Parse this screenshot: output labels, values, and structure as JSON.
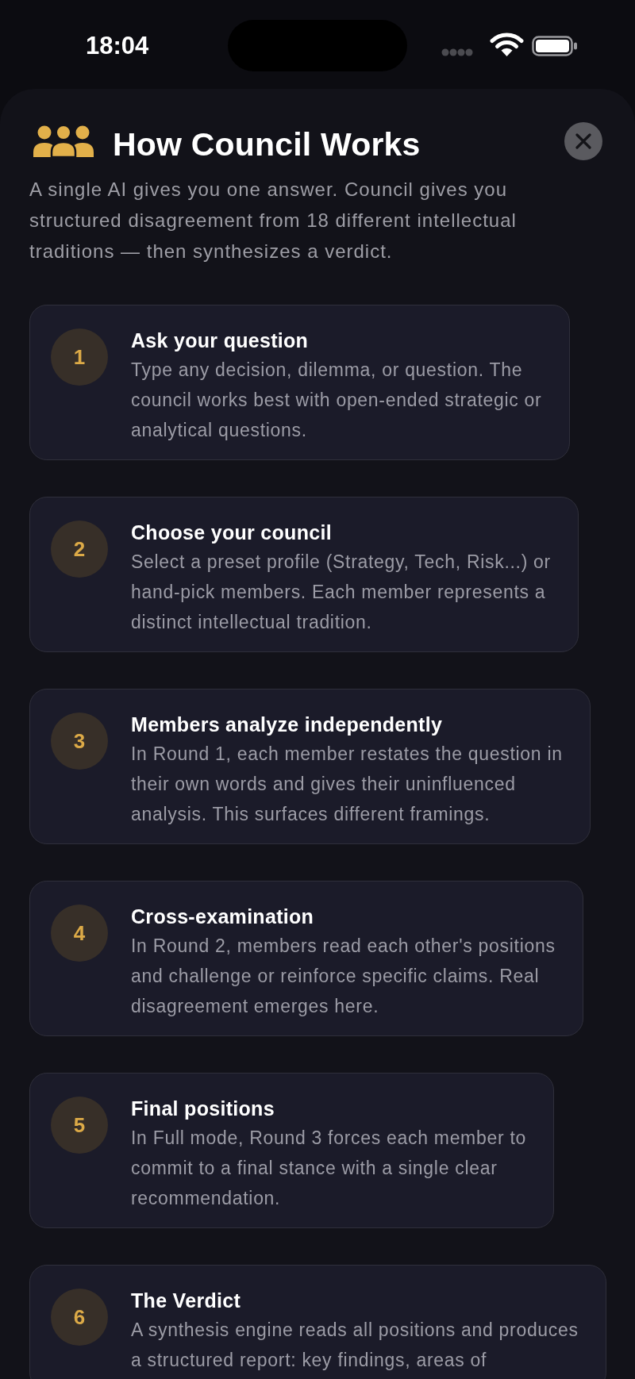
{
  "status_bar": {
    "time": "18:04"
  },
  "sheet": {
    "title": "How Council Works",
    "intro": "A single AI gives you one answer. Council gives you structured disagreement from 18 different intellectual traditions — then synthesizes a verdict.",
    "steps": [
      {
        "number": "1",
        "title": "Ask your question",
        "description": "Type any decision, dilemma, or question. The council works best with open-ended strategic or analytical questions."
      },
      {
        "number": "2",
        "title": "Choose your council",
        "description": "Select a preset profile (Strategy, Tech, Risk...) or hand-pick members. Each member represents a distinct intellectual tradition."
      },
      {
        "number": "3",
        "title": "Members analyze independently",
        "description": "In Round 1, each member restates the question in their own words and gives their uninfluenced analysis. This surfaces different framings."
      },
      {
        "number": "4",
        "title": "Cross-examination",
        "description": "In Round 2, members read each other's positions and challenge or reinforce specific claims. Real disagreement emerges here."
      },
      {
        "number": "5",
        "title": "Final positions",
        "description": "In Full mode, Round 3 forces each member to commit to a final stance with a single clear recommendation."
      },
      {
        "number": "6",
        "title": "The Verdict",
        "description": "A synthesis engine reads all positions and produces a structured report: key findings, areas of"
      }
    ]
  }
}
